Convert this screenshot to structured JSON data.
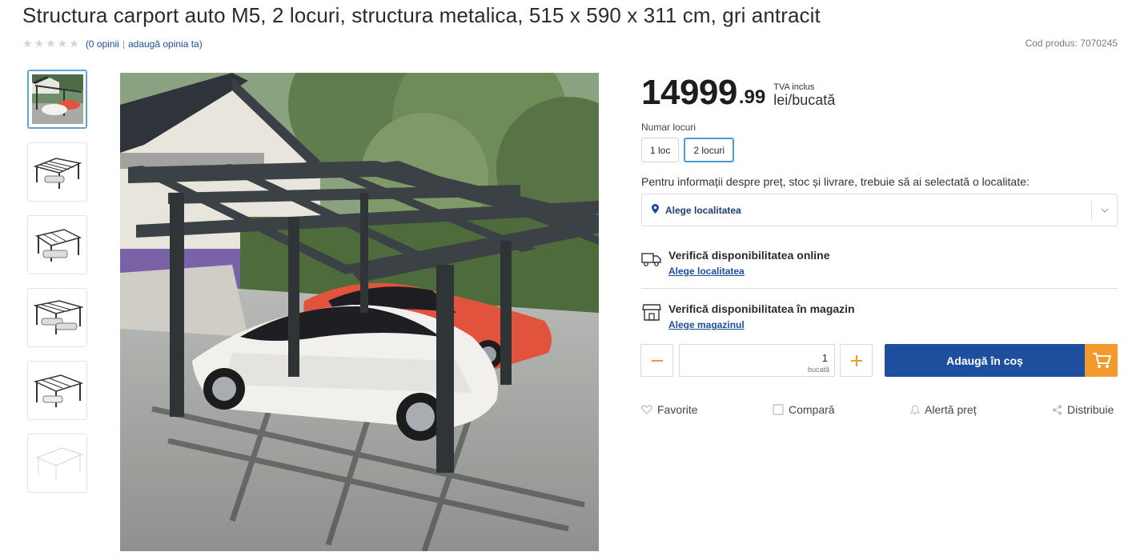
{
  "product": {
    "title": "Structura carport auto M5, 2 locuri, structura metalica, 515 x 590 x 311 cm, gri antracit",
    "reviews_link": "(0 opinii",
    "separator": "|",
    "add_review_link": "adaugă opinia ta)",
    "rating": 0,
    "rating_max": 5,
    "code": "Cod produs: 7070245"
  },
  "gallery": {
    "thumbnails": [
      "carport-photo",
      "carport-drawing-1",
      "carport-drawing-2",
      "carport-drawing-3",
      "carport-drawing-4",
      "carport-drawing-5"
    ],
    "active_index": 0
  },
  "price": {
    "integer": "14999",
    "decimals": ".99",
    "tva": "TVA inclus",
    "unit": "lei/bucată"
  },
  "variants": {
    "label": "Numar locuri",
    "options": [
      "1 loc",
      "2 locuri"
    ],
    "selected": "2 locuri"
  },
  "location": {
    "info_text": "Pentru informații despre preț, stoc și livrare, trebuie să ai selectată o localitate:",
    "select_placeholder": "Alege localitatea"
  },
  "availability": {
    "online_title": "Verifică disponibilitatea online",
    "online_link": "Alege localitatea",
    "store_title": "Verifică disponibilitatea în magazin",
    "store_link": "Alege magazinul"
  },
  "quantity": {
    "value": "1",
    "unit": "bucată"
  },
  "cart": {
    "add_label": "Adaugă în coș"
  },
  "actions": {
    "favorite": "Favorite",
    "compare": "Compară",
    "price_alert": "Alertă preț",
    "share": "Distribuie"
  },
  "colors": {
    "primary": "#1e4f9f",
    "accent": "#f39a2d",
    "link": "#1d4e9e"
  }
}
